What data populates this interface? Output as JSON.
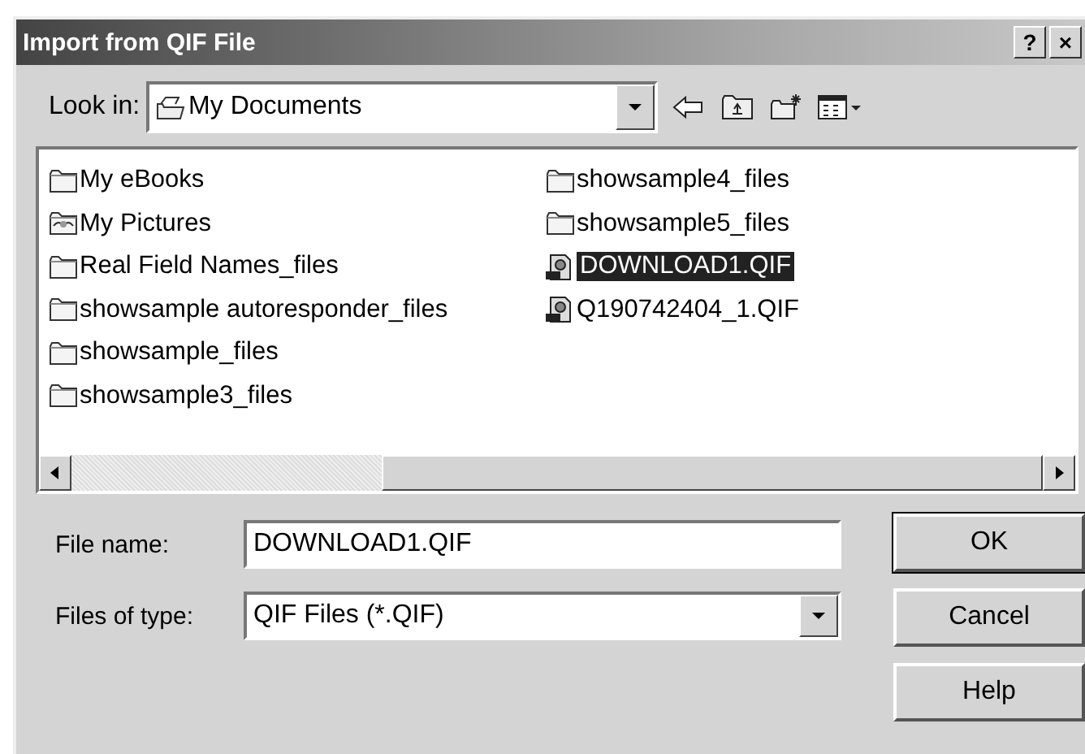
{
  "window": {
    "title": "Import from QIF File",
    "title_buttons": [
      "?",
      "×"
    ]
  },
  "look_in": {
    "label": "Look in:",
    "value": "My Documents"
  },
  "files": [
    {
      "name": "My eBooks",
      "kind": "folder",
      "selected": false
    },
    {
      "name": "My Pictures",
      "kind": "pictures",
      "selected": false
    },
    {
      "name": "Real Field Names_files",
      "kind": "folder",
      "selected": false
    },
    {
      "name": "showsample autoresponder_files",
      "kind": "folder",
      "selected": false
    },
    {
      "name": "showsample_files",
      "kind": "folder",
      "selected": false
    },
    {
      "name": "showsample3_files",
      "kind": "folder",
      "selected": false
    },
    {
      "name": "showsample4_files",
      "kind": "folder",
      "selected": false
    },
    {
      "name": "showsample5_files",
      "kind": "folder",
      "selected": false
    },
    {
      "name": "DOWNLOAD1.QIF",
      "kind": "file",
      "selected": true
    },
    {
      "name": "Q190742404_1.QIF",
      "kind": "file",
      "selected": false
    }
  ],
  "file_name": {
    "label": "File name:",
    "value": "DOWNLOAD1.QIF"
  },
  "file_type": {
    "label": "Files of type:",
    "value": "QIF Files (*.QIF)"
  },
  "buttons": [
    "OK",
    "Cancel",
    "Help"
  ]
}
